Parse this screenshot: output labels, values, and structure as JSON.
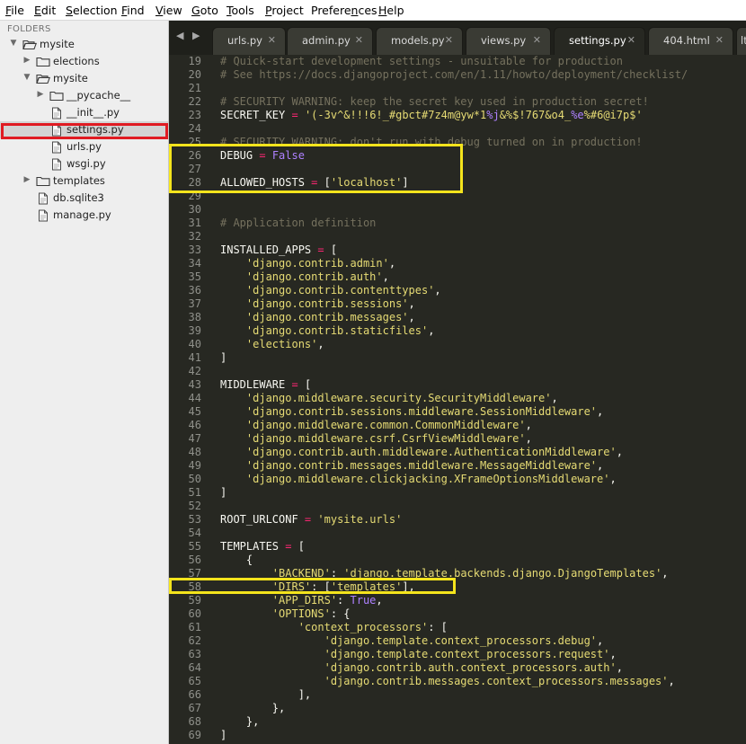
{
  "menu": [
    {
      "label": "File",
      "underline": "F",
      "rest": "ile"
    },
    {
      "label": "Edit",
      "underline": "E",
      "rest": "dit"
    },
    {
      "label": "Selection",
      "underline": "S",
      "rest": "election"
    },
    {
      "label": "Find",
      "underline": "F",
      "rest": "ind",
      "pre": ""
    },
    {
      "label": "View",
      "underline": "V",
      "rest": "iew"
    },
    {
      "label": "Goto",
      "underline": "G",
      "rest": "oto"
    },
    {
      "label": "Tools",
      "underline": "T",
      "rest": "ools"
    },
    {
      "label": "Project",
      "underline": "P",
      "rest": "roject"
    },
    {
      "label": "Preferences",
      "underline": "n",
      "pre": "Prefere",
      "rest": "ces"
    },
    {
      "label": "Help",
      "underline": "H",
      "rest": "elp"
    }
  ],
  "sidebar": {
    "header": "FOLDERS",
    "items": [
      {
        "label": "mysite",
        "type": "folder-open",
        "depth": 0,
        "arrow": "down"
      },
      {
        "label": "elections",
        "type": "folder",
        "depth": 1,
        "arrow": "right"
      },
      {
        "label": "mysite",
        "type": "folder-open",
        "depth": 1,
        "arrow": "down"
      },
      {
        "label": "__pycache__",
        "type": "folder",
        "depth": 2,
        "arrow": "right"
      },
      {
        "label": "__init__.py",
        "type": "file",
        "depth": 2
      },
      {
        "label": "settings.py",
        "type": "file",
        "depth": 2,
        "selected": true
      },
      {
        "label": "urls.py",
        "type": "file",
        "depth": 2
      },
      {
        "label": "wsgi.py",
        "type": "file",
        "depth": 2
      },
      {
        "label": "templates",
        "type": "folder",
        "depth": 1,
        "arrow": "right"
      },
      {
        "label": "db.sqlite3",
        "type": "file",
        "depth": 1
      },
      {
        "label": "manage.py",
        "type": "file",
        "depth": 1
      }
    ]
  },
  "tabs": [
    {
      "label": "urls.py",
      "active": false
    },
    {
      "label": "admin.py",
      "active": false
    },
    {
      "label": "models.py",
      "active": false
    },
    {
      "label": "views.py",
      "active": false
    },
    {
      "label": "settings.py",
      "active": true
    },
    {
      "label": "404.html",
      "active": false
    },
    {
      "label": "lt.",
      "active": false
    }
  ],
  "editor": {
    "lines": [
      {
        "n": "19",
        "tokens": [
          [
            "c",
            "# Quick-start development settings - unsuitable for production"
          ]
        ]
      },
      {
        "n": "20",
        "tokens": [
          [
            "c",
            "# See https://docs.djangoproject.com/en/1.11/howto/deployment/checklist/"
          ]
        ]
      },
      {
        "n": "21",
        "tokens": []
      },
      {
        "n": "22",
        "tokens": [
          [
            "c",
            "# SECURITY WARNING: keep the secret key used in production secret!"
          ]
        ]
      },
      {
        "n": "23",
        "tokens": [
          [
            "p",
            "SECRET_KEY "
          ],
          [
            "k",
            "="
          ],
          [
            "p",
            " "
          ],
          [
            "s",
            "'(-3v^&!!!6!_#gbct#7z4m@yw*1"
          ],
          [
            "n",
            "%j"
          ],
          [
            "s",
            "&%$!767&o4_"
          ],
          [
            "n",
            "%e"
          ],
          [
            "s",
            "%#6@i7p$'"
          ]
        ]
      },
      {
        "n": "24",
        "tokens": []
      },
      {
        "n": "25",
        "tokens": [
          [
            "c",
            "# SECURITY WARNING: don't run with debug turned on in production!"
          ]
        ]
      },
      {
        "n": "26",
        "tokens": [
          [
            "p",
            "DEBUG "
          ],
          [
            "k",
            "="
          ],
          [
            "p",
            " "
          ],
          [
            "n",
            "False"
          ]
        ]
      },
      {
        "n": "27",
        "tokens": []
      },
      {
        "n": "28",
        "tokens": [
          [
            "p",
            "ALLOWED_HOSTS "
          ],
          [
            "k",
            "="
          ],
          [
            "p",
            " ["
          ],
          [
            "s",
            "'localhost'"
          ],
          [
            "p",
            "]"
          ]
        ]
      },
      {
        "n": "29",
        "tokens": []
      },
      {
        "n": "30",
        "tokens": []
      },
      {
        "n": "31",
        "tokens": [
          [
            "c",
            "# Application definition"
          ]
        ]
      },
      {
        "n": "32",
        "tokens": []
      },
      {
        "n": "33",
        "tokens": [
          [
            "p",
            "INSTALLED_APPS "
          ],
          [
            "k",
            "="
          ],
          [
            "p",
            " ["
          ]
        ]
      },
      {
        "n": "34",
        "tokens": [
          [
            "p",
            "    "
          ],
          [
            "s",
            "'django.contrib.admin'"
          ],
          [
            "p",
            ","
          ]
        ]
      },
      {
        "n": "35",
        "tokens": [
          [
            "p",
            "    "
          ],
          [
            "s",
            "'django.contrib.auth'"
          ],
          [
            "p",
            ","
          ]
        ]
      },
      {
        "n": "36",
        "tokens": [
          [
            "p",
            "    "
          ],
          [
            "s",
            "'django.contrib.contenttypes'"
          ],
          [
            "p",
            ","
          ]
        ]
      },
      {
        "n": "37",
        "tokens": [
          [
            "p",
            "    "
          ],
          [
            "s",
            "'django.contrib.sessions'"
          ],
          [
            "p",
            ","
          ]
        ]
      },
      {
        "n": "38",
        "tokens": [
          [
            "p",
            "    "
          ],
          [
            "s",
            "'django.contrib.messages'"
          ],
          [
            "p",
            ","
          ]
        ]
      },
      {
        "n": "39",
        "tokens": [
          [
            "p",
            "    "
          ],
          [
            "s",
            "'django.contrib.staticfiles'"
          ],
          [
            "p",
            ","
          ]
        ]
      },
      {
        "n": "40",
        "tokens": [
          [
            "p",
            "    "
          ],
          [
            "s",
            "'elections'"
          ],
          [
            "p",
            ","
          ]
        ]
      },
      {
        "n": "41",
        "tokens": [
          [
            "p",
            "]"
          ]
        ]
      },
      {
        "n": "42",
        "tokens": []
      },
      {
        "n": "43",
        "tokens": [
          [
            "p",
            "MIDDLEWARE "
          ],
          [
            "k",
            "="
          ],
          [
            "p",
            " ["
          ]
        ]
      },
      {
        "n": "44",
        "tokens": [
          [
            "p",
            "    "
          ],
          [
            "s",
            "'django.middleware.security.SecurityMiddleware'"
          ],
          [
            "p",
            ","
          ]
        ]
      },
      {
        "n": "45",
        "tokens": [
          [
            "p",
            "    "
          ],
          [
            "s",
            "'django.contrib.sessions.middleware.SessionMiddleware'"
          ],
          [
            "p",
            ","
          ]
        ]
      },
      {
        "n": "46",
        "tokens": [
          [
            "p",
            "    "
          ],
          [
            "s",
            "'django.middleware.common.CommonMiddleware'"
          ],
          [
            "p",
            ","
          ]
        ]
      },
      {
        "n": "47",
        "tokens": [
          [
            "p",
            "    "
          ],
          [
            "s",
            "'django.middleware.csrf.CsrfViewMiddleware'"
          ],
          [
            "p",
            ","
          ]
        ]
      },
      {
        "n": "48",
        "tokens": [
          [
            "p",
            "    "
          ],
          [
            "s",
            "'django.contrib.auth.middleware.AuthenticationMiddleware'"
          ],
          [
            "p",
            ","
          ]
        ]
      },
      {
        "n": "49",
        "tokens": [
          [
            "p",
            "    "
          ],
          [
            "s",
            "'django.contrib.messages.middleware.MessageMiddleware'"
          ],
          [
            "p",
            ","
          ]
        ]
      },
      {
        "n": "50",
        "tokens": [
          [
            "p",
            "    "
          ],
          [
            "s",
            "'django.middleware.clickjacking.XFrameOptionsMiddleware'"
          ],
          [
            "p",
            ","
          ]
        ]
      },
      {
        "n": "51",
        "tokens": [
          [
            "p",
            "]"
          ]
        ]
      },
      {
        "n": "52",
        "tokens": []
      },
      {
        "n": "53",
        "tokens": [
          [
            "p",
            "ROOT_URLCONF "
          ],
          [
            "k",
            "="
          ],
          [
            "p",
            " "
          ],
          [
            "s",
            "'mysite.urls'"
          ]
        ]
      },
      {
        "n": "54",
        "tokens": []
      },
      {
        "n": "55",
        "tokens": [
          [
            "p",
            "TEMPLATES "
          ],
          [
            "k",
            "="
          ],
          [
            "p",
            " ["
          ]
        ]
      },
      {
        "n": "56",
        "tokens": [
          [
            "p",
            "    {"
          ]
        ]
      },
      {
        "n": "57",
        "tokens": [
          [
            "p",
            "        "
          ],
          [
            "s",
            "'BACKEND'"
          ],
          [
            "p",
            ": "
          ],
          [
            "s",
            "'django.template.backends.django.DjangoTemplates'"
          ],
          [
            "p",
            ","
          ]
        ]
      },
      {
        "n": "58",
        "tokens": [
          [
            "p",
            "        "
          ],
          [
            "s",
            "'DIRS'"
          ],
          [
            "p",
            ": ["
          ],
          [
            "s",
            "'templates'"
          ],
          [
            "p",
            "],"
          ]
        ]
      },
      {
        "n": "59",
        "tokens": [
          [
            "p",
            "        "
          ],
          [
            "s",
            "'APP_DIRS'"
          ],
          [
            "p",
            ": "
          ],
          [
            "n",
            "True"
          ],
          [
            "p",
            ","
          ]
        ]
      },
      {
        "n": "60",
        "tokens": [
          [
            "p",
            "        "
          ],
          [
            "s",
            "'OPTIONS'"
          ],
          [
            "p",
            ": {"
          ]
        ]
      },
      {
        "n": "61",
        "tokens": [
          [
            "p",
            "            "
          ],
          [
            "s",
            "'context_processors'"
          ],
          [
            "p",
            ": ["
          ]
        ]
      },
      {
        "n": "62",
        "tokens": [
          [
            "p",
            "                "
          ],
          [
            "s",
            "'django.template.context_processors.debug'"
          ],
          [
            "p",
            ","
          ]
        ]
      },
      {
        "n": "63",
        "tokens": [
          [
            "p",
            "                "
          ],
          [
            "s",
            "'django.template.context_processors.request'"
          ],
          [
            "p",
            ","
          ]
        ]
      },
      {
        "n": "64",
        "tokens": [
          [
            "p",
            "                "
          ],
          [
            "s",
            "'django.contrib.auth.context_processors.auth'"
          ],
          [
            "p",
            ","
          ]
        ]
      },
      {
        "n": "65",
        "tokens": [
          [
            "p",
            "                "
          ],
          [
            "s",
            "'django.contrib.messages.context_processors.messages'"
          ],
          [
            "p",
            ","
          ]
        ]
      },
      {
        "n": "66",
        "tokens": [
          [
            "p",
            "            ],"
          ]
        ]
      },
      {
        "n": "67",
        "tokens": [
          [
            "p",
            "        },"
          ]
        ]
      },
      {
        "n": "68",
        "tokens": [
          [
            "p",
            "    },"
          ]
        ]
      },
      {
        "n": "69",
        "tokens": [
          [
            "p",
            "]"
          ]
        ]
      }
    ]
  },
  "colors": {
    "editor_bg": "#272822",
    "sidebar_bg": "#eeeeee",
    "selection_outline": "#e01b22",
    "highlight_box": "#f4e41c",
    "comment": "#75715e",
    "string": "#e6db74",
    "keyword": "#f92672",
    "constant": "#ae81ff"
  }
}
